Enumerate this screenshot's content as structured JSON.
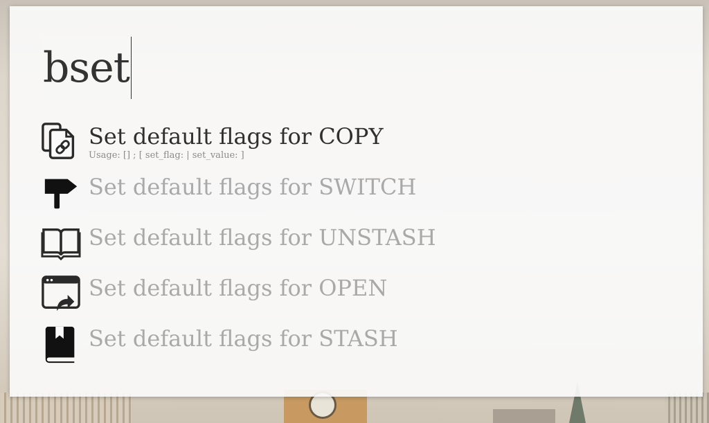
{
  "query": {
    "text": "bset"
  },
  "results": [
    {
      "title": "Set default flags for COPY",
      "subtitle": "Usage:  [] ; [ set_flag: | set_value: ]",
      "icon": "copy-link-icon",
      "selected": true
    },
    {
      "title": "Set default flags for SWITCH",
      "icon": "signpost-icon",
      "selected": false
    },
    {
      "title": "Set default flags for UNSTASH",
      "icon": "open-book-icon",
      "selected": false
    },
    {
      "title": "Set default flags for OPEN",
      "icon": "window-open-icon",
      "selected": false
    },
    {
      "title": "Set default flags for STASH",
      "icon": "bookmark-book-icon",
      "selected": false
    }
  ],
  "colors": {
    "selected_text": "#2f2f2f",
    "unselected_text": "#a9a9a9",
    "panel_bg": "#fafafa"
  }
}
